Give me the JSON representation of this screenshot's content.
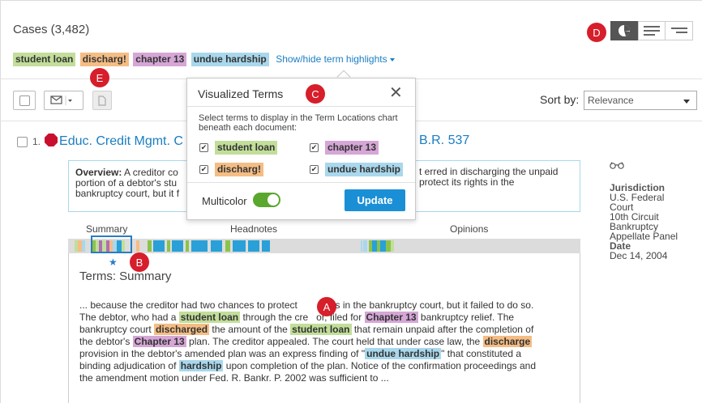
{
  "header": {
    "cases_title": "Cases (3,482)"
  },
  "terms": [
    {
      "label": "student loan",
      "color": "#c2de9a"
    },
    {
      "label": "discharg!",
      "color": "#f4bd84"
    },
    {
      "label": "chapter 13",
      "color": "#d5a6d6"
    },
    {
      "label": "undue hardship",
      "color": "#a9d7ec"
    }
  ],
  "show_hide_label": "Show/hide term highlights",
  "badges": {
    "a": "A",
    "b": "B",
    "c": "C",
    "d": "D",
    "e": "E"
  },
  "view_icons": [
    "pie-chart-icon",
    "list-view-icon",
    "compact-view-icon"
  ],
  "toolbar": {
    "select_all_icon": "checkbox-icon",
    "email_icon": "envelope-icon",
    "download_icon": "document-icon"
  },
  "sort": {
    "label": "Sort by:",
    "selected": "Relevance"
  },
  "result": {
    "number": "1.",
    "title_start": "Educ. Credit Mgmt. C",
    "title_end": "B.R. 537",
    "overview_label": "Overview:",
    "overview_line1_start": "A creditor co",
    "overview_line1_end": "t erred in discharging the unpaid",
    "overview_line2_start": "portion of a debtor's stu",
    "overview_line2_end": "protect its rights in the",
    "overview_line3": "bankruptcy court, but it f"
  },
  "sidebar": {
    "glasses_icon": "glasses-icon",
    "jurisdiction_label": "Jurisdiction",
    "jurisdiction_lines": [
      "U.S. Federal",
      "Court",
      "10th Circuit",
      "Bankruptcy",
      "Appellate Panel"
    ],
    "date_label": "Date",
    "date_value": "Dec 14, 2004"
  },
  "tabs": {
    "summary": "Summary",
    "headnotes": "Headnotes",
    "opinions": "Opinions"
  },
  "terms_summary_title": "Terms: Summary",
  "snippet": {
    "l1a": "... because the creditor had two chances to protect",
    "l1b": "ghts in the bankruptcy court, but it failed to do so.",
    "l2a": "The debtor, who had a ",
    "l2_hl1": "student loan",
    "l2b": " through the cre",
    "l2c": "or, filed for ",
    "l2_hl2": "Chapter 13",
    "l2d": " bankruptcy relief. The",
    "l3a": "bankruptcy court ",
    "l3_hl1": "discharged",
    "l3b": " the amount of the ",
    "l3_hl2": "student loan",
    "l3c": " that remain unpaid after the completion of",
    "l4a": "the debtor's ",
    "l4_hl1": "Chapter 13",
    "l4b": " plan. The creditor appealed. The court held that under case law, the ",
    "l4_hl2": "discharge",
    "l5a": "provision in the debtor's amended plan was an express finding of \"",
    "l5_hl": "undue hardship",
    "l5b": "\" that constituted a",
    "l6a": "binding adjudication of ",
    "l6_hl": "hardship",
    "l6b": " upon completion of the plan. Notice of the confirmation proceedings and",
    "l7": "the amendment motion under Fed. R. Bankr. P. 2002 was sufficient to ..."
  },
  "popup": {
    "title": "Visualized Terms",
    "close_icon": "close-icon",
    "description": "Select terms to display in the Term Locations chart beneath each document:",
    "options": [
      {
        "label": "student loan",
        "checked": true
      },
      {
        "label": "chapter 13",
        "checked": true
      },
      {
        "label": "discharg!",
        "checked": true
      },
      {
        "label": "undue hardship",
        "checked": true
      }
    ],
    "check_mark": "✔",
    "multicolor_label": "Multicolor",
    "multicolor_on": true,
    "update_label": "Update"
  }
}
